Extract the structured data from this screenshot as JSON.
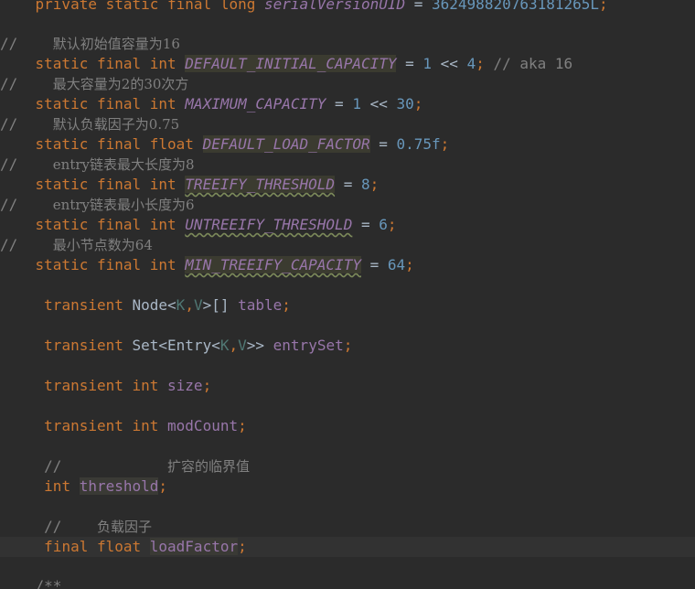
{
  "code": {
    "l0_kw": "private static final long ",
    "l0_name": "serialVersionUID",
    "l0_eq": " = ",
    "l0_num": "362498820763181265L",
    "l0_semi": ";",
    "c1_slash": "//",
    "c1_text": "默认初始值容量为16",
    "l1_kw": "static final int ",
    "l1_name": "DEFAULT_INITIAL_CAPACITY",
    "l1_eq": " = ",
    "l1_num1": "1",
    "l1_op": " << ",
    "l1_num2": "4",
    "l1_semi": "; ",
    "l1_cmt": "// aka 16",
    "c2_slash": "//",
    "c2_text": "最大容量为2的30次方",
    "l2_kw": "static final int ",
    "l2_name": "MAXIMUM_CAPACITY",
    "l2_eq": " = ",
    "l2_num1": "1",
    "l2_op": " << ",
    "l2_num2": "30",
    "l2_semi": ";",
    "c3_slash": "//",
    "c3_text": "默认负载因子为0.75",
    "l3_kw": "static final float ",
    "l3_name": "DEFAULT_LOAD_FACTOR",
    "l3_eq": " = ",
    "l3_num": "0.75f",
    "l3_semi": ";",
    "c4_slash": "//",
    "c4_text": "entry链表最大长度为8",
    "l4_kw": "static final int ",
    "l4_name": "TREEIFY_THRESHOLD",
    "l4_eq": " = ",
    "l4_num": "8",
    "l4_semi": ";",
    "c5_slash": "//",
    "c5_text": "entry链表最小长度为6",
    "l5_kw": "static final int ",
    "l5_name": "UNTREEIFY_THRESHOLD",
    "l5_eq": " = ",
    "l5_num": "6",
    "l5_semi": ";",
    "c6_slash": "//",
    "c6_text": "最小节点数为64",
    "l6_kw": "static final int ",
    "l6_name": "MIN_TREEIFY_CAPACITY",
    "l6_eq": " = ",
    "l6_num": "64",
    "l6_semi": ";",
    "f1_kw": "transient ",
    "f1_type": "Node<",
    "f1_k": "K",
    "f1_comma": ",",
    "f1_v": "V",
    "f1_close": ">[] ",
    "f1_name": "table",
    "f1_semi": ";",
    "f2_kw": "transient ",
    "f2_type": "Set<Entry<",
    "f2_k": "K",
    "f2_comma": ",",
    "f2_v": "V",
    "f2_close": ">> ",
    "f2_name": "entrySet",
    "f2_semi": ";",
    "f3_kw": "transient int ",
    "f3_name": "size",
    "f3_semi": ";",
    "f4_kw": "transient int ",
    "f4_name": "modCount",
    "f4_semi": ";",
    "c7_slash": "//",
    "c7_text": "扩容的临界值",
    "f5_kw": "int ",
    "f5_name": "threshold",
    "f5_semi": ";",
    "c8_slash": "//",
    "c8_text": "负载因子",
    "f6_kw": "final float ",
    "f6_name": "loadFactor",
    "f6_semi": ";",
    "tail": "/**"
  }
}
